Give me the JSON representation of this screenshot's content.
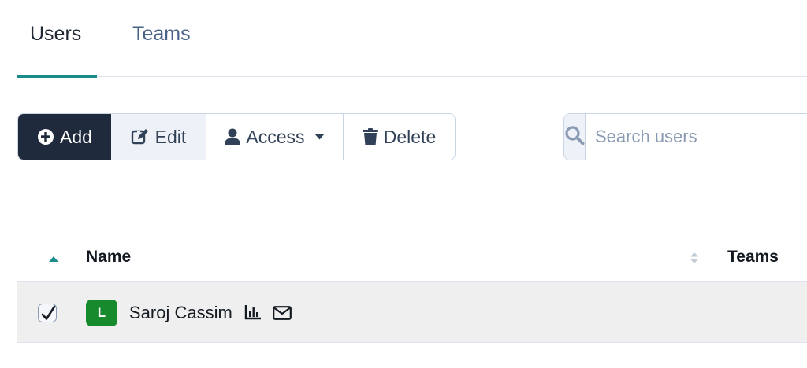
{
  "tabs": [
    {
      "label": "Users",
      "active": true
    },
    {
      "label": "Teams",
      "active": false
    }
  ],
  "toolbar": {
    "add_label": "Add",
    "edit_label": "Edit",
    "access_label": "Access",
    "delete_label": "Delete"
  },
  "search": {
    "placeholder": "Search users",
    "value": ""
  },
  "table": {
    "columns": [
      {
        "label": "Name",
        "sort": "ascending"
      },
      {
        "label": "Teams",
        "sort": "none"
      }
    ],
    "rows": [
      {
        "selected": true,
        "avatar_initial": "L",
        "avatar_color": "#178a2e",
        "name": "Saroj Cassim",
        "icons": [
          "chart-icon",
          "mail-icon"
        ]
      }
    ]
  },
  "colors": {
    "accent": "#1a8c8c",
    "primary_button": "#1f2a3c",
    "tab_inactive": "#4a6387"
  }
}
